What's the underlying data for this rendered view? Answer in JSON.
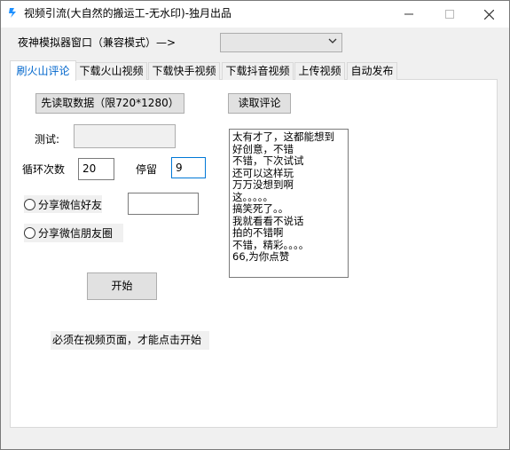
{
  "window": {
    "title": "视频引流(大自然的搬运工-无水印)-独月出品",
    "controls": {
      "minimize": "—",
      "maximize": "☐",
      "close": "✕"
    }
  },
  "emulator": {
    "label": "夜神模拟器窗口（兼容模式）—>",
    "selected_value": ""
  },
  "tabs": [
    {
      "label": "刷火山评论",
      "active": true
    },
    {
      "label": "下载火山视频",
      "active": false
    },
    {
      "label": "下载快手视频",
      "active": false
    },
    {
      "label": "下载抖音视频",
      "active": false
    },
    {
      "label": "上传视频",
      "active": false
    },
    {
      "label": "自动发布",
      "active": false
    }
  ],
  "form": {
    "read_data_button": "先读取数据（限720*1280）",
    "read_comments_button": "读取评论",
    "test_label": "测试:",
    "test_value": "",
    "loop_label": "循环次数",
    "loop_value": "20",
    "stay_label": "停留",
    "stay_value": "9",
    "share_friend_label": "分享微信好友",
    "share_friend_value": "",
    "share_moments_label": "分享微信朋友圈",
    "start_button": "开始",
    "note": "必须在视频页面，才能点击开始"
  },
  "comments": [
    "太有才了，这都能想到",
    "好创意，不错",
    "不错，下次试试",
    "还可以这样玩",
    "万万没想到啊",
    "这。。。。。",
    "搞笑死了。。",
    "我就看看不说话",
    "拍的不错啊",
    "不错，精彩。。。。",
    "66,为你点赞"
  ],
  "colors": {
    "accent": "#0078d7",
    "tab_active_text": "#0066cc",
    "window_bg": "#f0f0f0"
  }
}
